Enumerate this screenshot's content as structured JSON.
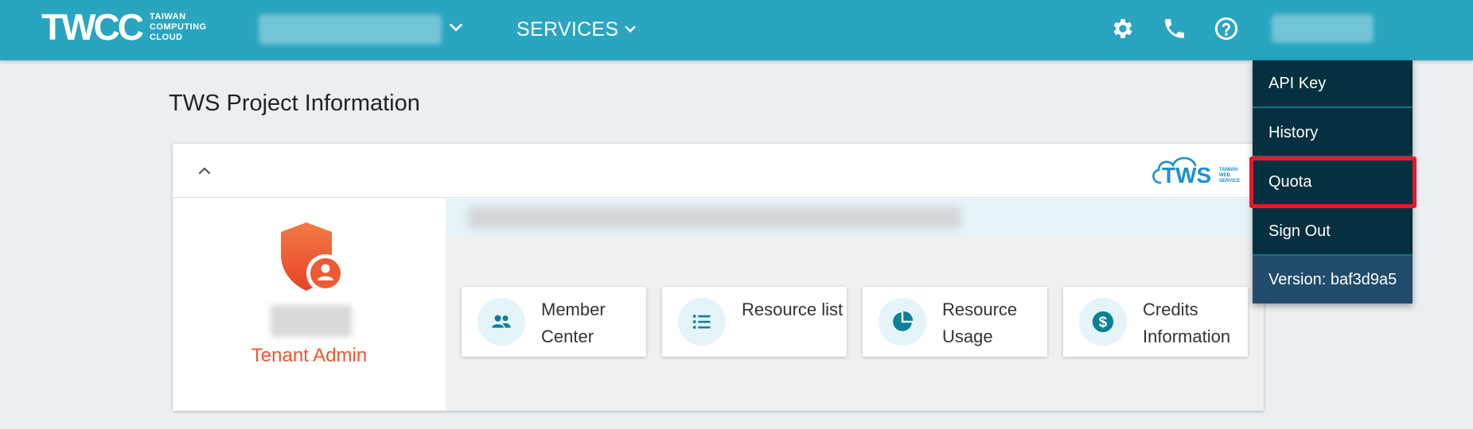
{
  "header": {
    "logo_mark": "TWCC",
    "logo_text_lines": [
      "TAIWAN",
      "COMPUTING",
      "CLOUD"
    ],
    "services_label": "SERVICES",
    "icons": [
      "gear-icon",
      "phone-icon",
      "help-circle-icon"
    ]
  },
  "dropdown": {
    "items": [
      "API Key",
      "History",
      "Quota",
      "Sign Out"
    ],
    "version": "Version: baf3d9a5",
    "highlighted_item": "Quota"
  },
  "page": {
    "title": "TWS Project Information"
  },
  "card": {
    "tws_logo": "TWS",
    "tws_logo_subtext": [
      "TAIWAN",
      "WEB",
      "SERVICE"
    ],
    "role": "Tenant Admin",
    "tiles": [
      {
        "label": "Member Center",
        "icon": "people-icon"
      },
      {
        "label": "Resource list",
        "icon": "list-icon"
      },
      {
        "label": "Resource Usage",
        "icon": "pie-chart-icon"
      },
      {
        "label": "Credits Information",
        "icon": "dollar-coin-icon"
      }
    ]
  },
  "colors": {
    "topbar": "#29a5c0",
    "dropdown_bg": "#05303f",
    "version_bg": "#214c6b",
    "highlight": "#e8182b",
    "role_accent": "#f2552c",
    "icon_accent": "#0d7f95"
  }
}
